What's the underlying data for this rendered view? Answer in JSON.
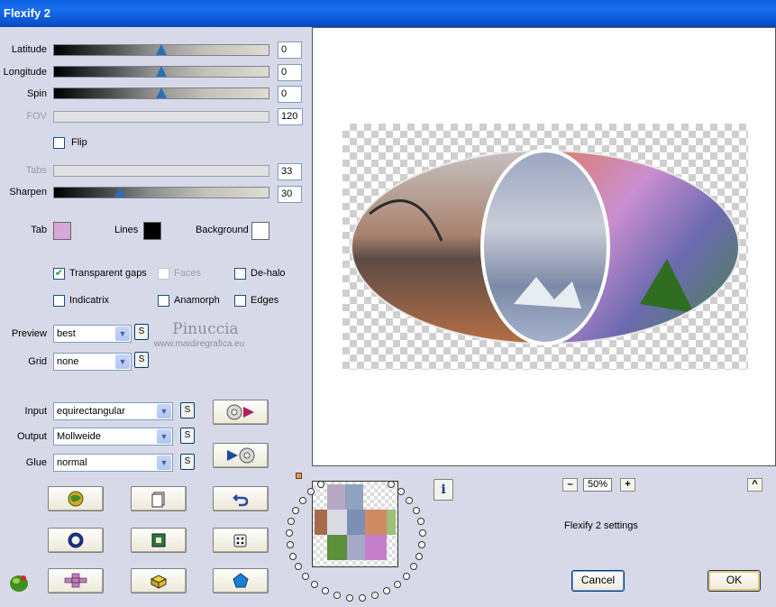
{
  "window": {
    "title": "Flexify 2"
  },
  "sliders": [
    {
      "label": "Latitude",
      "value": "0",
      "level": 0.5,
      "enabled": true
    },
    {
      "label": "Longitude",
      "value": "0",
      "level": 0.5,
      "enabled": true
    },
    {
      "label": "Spin",
      "value": "0",
      "level": 0.5,
      "enabled": true
    },
    {
      "label": "FOV",
      "value": "120",
      "enabled": false
    },
    {
      "label": "Tabs",
      "value": "33",
      "enabled": false
    },
    {
      "label": "Sharpen",
      "value": "30",
      "level": 0.3,
      "enabled": true
    }
  ],
  "flip": {
    "label": "Flip",
    "checked": false
  },
  "colors": {
    "tab": {
      "label": "Tab",
      "color": "#d9a6d9"
    },
    "lines": {
      "label": "Lines",
      "color": "#000000"
    },
    "background": {
      "label": "Background",
      "color": "#ffffff"
    }
  },
  "options": [
    {
      "label": "Transparent gaps",
      "checked": true,
      "enabled": true
    },
    {
      "label": "Faces",
      "checked": false,
      "enabled": false
    },
    {
      "label": "De-halo",
      "checked": false,
      "enabled": true
    },
    {
      "label": "Indicatrix",
      "checked": false,
      "enabled": true
    },
    {
      "label": "Anamorph",
      "checked": false,
      "enabled": true
    },
    {
      "label": "Edges",
      "checked": false,
      "enabled": true
    }
  ],
  "preview": {
    "label": "Preview",
    "value": "best",
    "s_label": "S"
  },
  "grid": {
    "label": "Grid",
    "value": "none",
    "s_label": "S"
  },
  "watermark": {
    "name": "Pinuccia",
    "site": "www.maidiregrafica.eu"
  },
  "input": {
    "label": "Input",
    "value": "equirectangular",
    "s_label": "S"
  },
  "output": {
    "label": "Output",
    "value": "Mollweide",
    "s_label": "S"
  },
  "glue": {
    "label": "Glue",
    "value": "normal",
    "s_label": "S"
  },
  "zoom": {
    "minus": "–",
    "value": "50%",
    "plus": "+"
  },
  "collapse_label": "^",
  "info_label": "i",
  "settings_text": "Flexify 2 settings",
  "cancel_label": "Cancel",
  "ok_label": "OK"
}
